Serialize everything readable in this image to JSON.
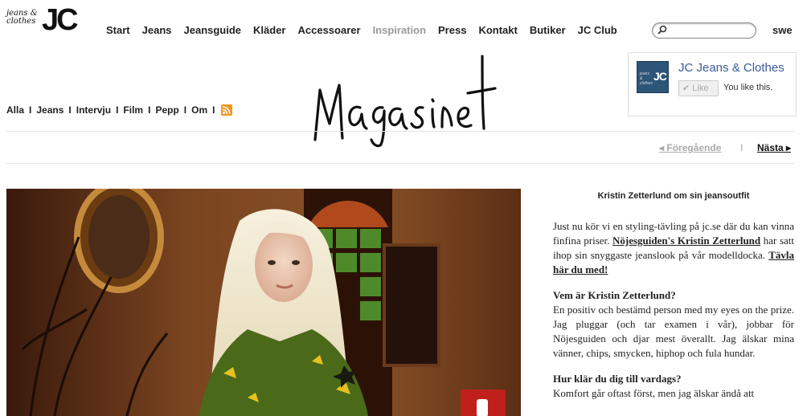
{
  "logo": {
    "small_text": "jeans & clothes",
    "big_text": "JC"
  },
  "nav": {
    "items": [
      "Start",
      "Jeans",
      "Jeansguide",
      "Kläder",
      "Accessoarer",
      "Inspiration",
      "Press",
      "Kontakt",
      "Butiker",
      "JC Club"
    ],
    "active": "Inspiration"
  },
  "search": {
    "value": "",
    "placeholder": ""
  },
  "lang": "swe",
  "facebook": {
    "page_name": "JC Jeans & Clothes",
    "like_label": "Like",
    "status": "You like this.",
    "thumb_text": "JC",
    "thumb_small": "jeans & clothes"
  },
  "subnav": {
    "items": [
      "Alla",
      "Jeans",
      "Intervju",
      "Film",
      "Pepp",
      "Om"
    ],
    "separator": "I"
  },
  "magazine_title": "Magasinet",
  "pager": {
    "prev": "◂ Föregående",
    "sep": "I",
    "next": "Nästa ▸"
  },
  "article": {
    "title": "Kristin Zetterlund om sin jeansoutfit",
    "intro_1": "Just nu kör vi en styling-tävling på jc.se där du kan vinna finfina priser.",
    "intro_link_1": "Nöjesguiden's Kristin Zetterlund",
    "intro_2": " har satt ihop sin snyggaste jeanslook på vår modelldocka. ",
    "intro_link_2": "Tävla här du med!",
    "q1": "Vem är Kristin Zetterlund?",
    "a1": "En positiv och bestämd person med my eyes on the prize. Jag pluggar (och tar examen i vår), jobbar för Nöjesguiden och djar mest överallt. Jag älskar mina vänner, chips, smycken, hiphop och fula hundar.",
    "q2": "Hur klär du dig till vardags?",
    "a2": "Komfort går oftast först, men jag älskar ändå att"
  },
  "colors": {
    "fb_blue": "#3b5998",
    "inactive_nav": "#999999",
    "rss_orange": "#f7941d"
  }
}
